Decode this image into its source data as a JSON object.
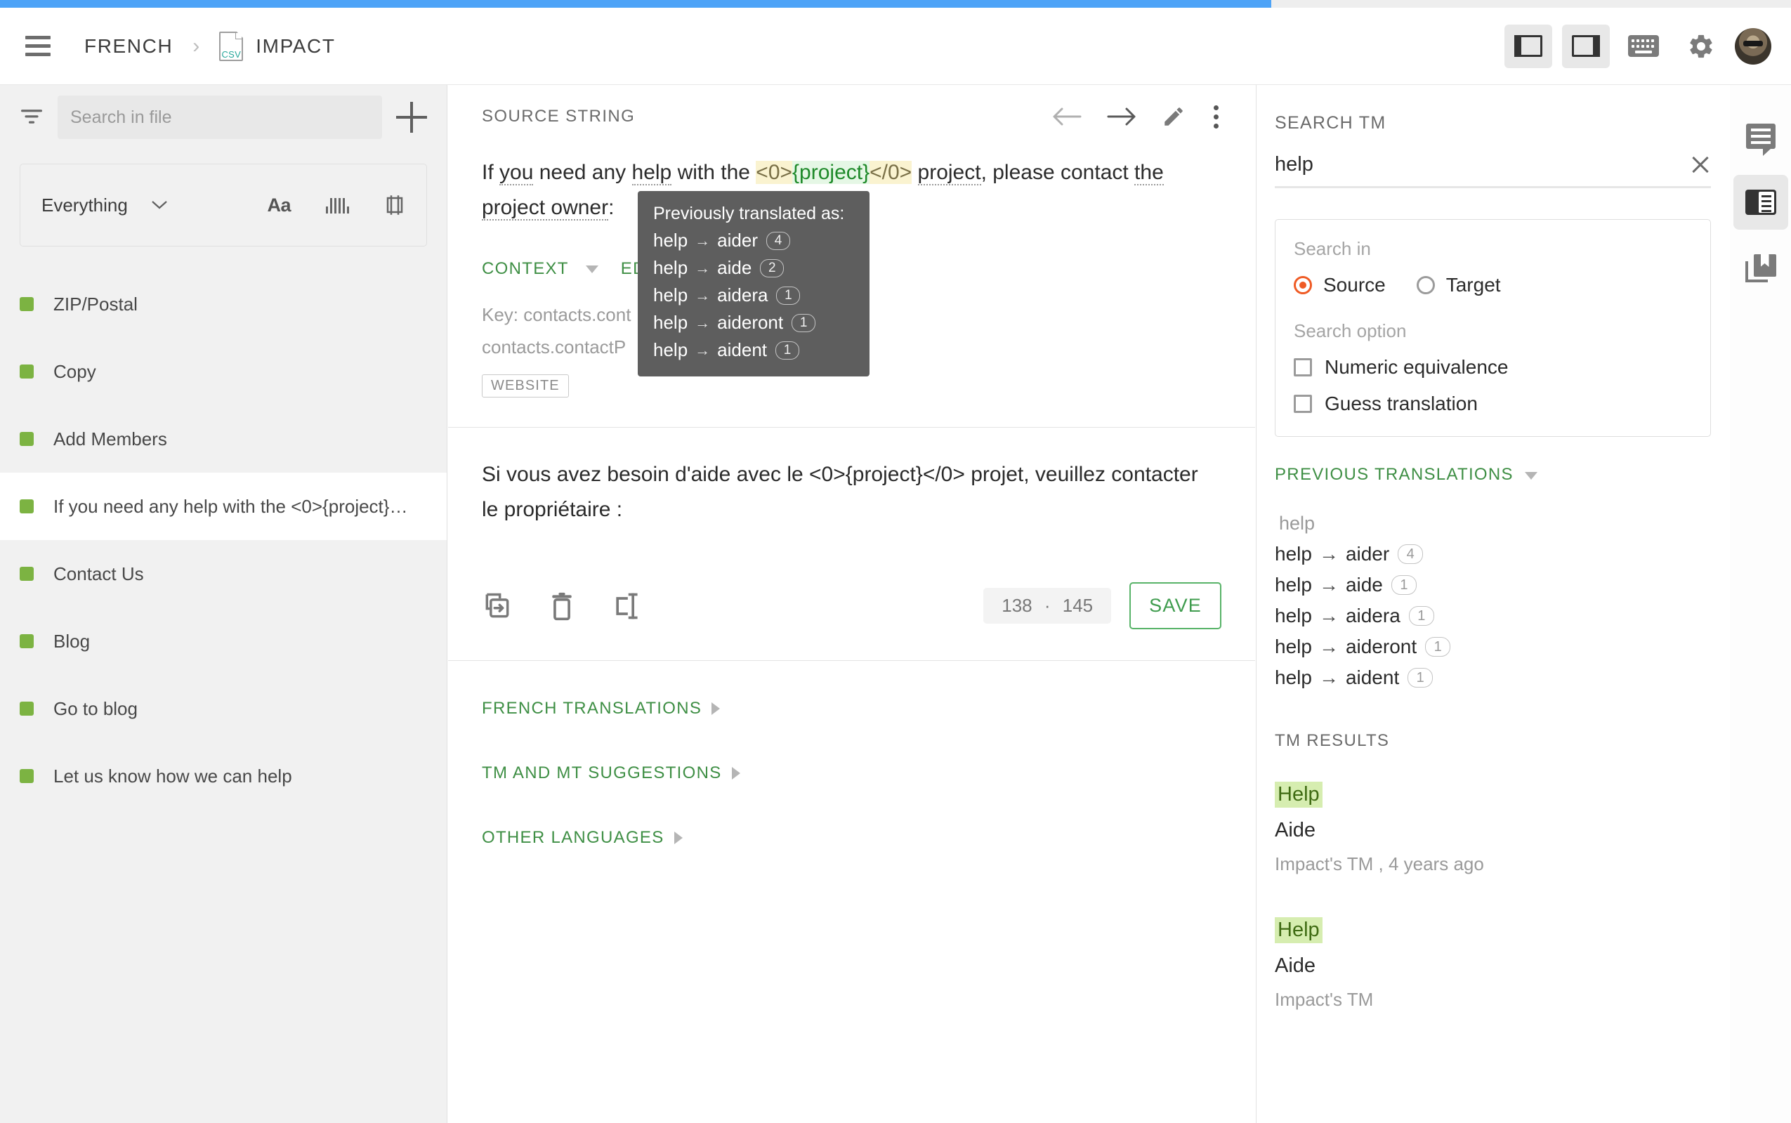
{
  "progress": {
    "percent": 71
  },
  "appbar": {
    "menu_icon": "hamburger-icon",
    "breadcrumb_language": "FRENCH",
    "breadcrumb_separator": "›",
    "file_type_label": "CSV",
    "breadcrumb_file": "IMPACT",
    "layout_left_icon": "layout-left-icon",
    "layout_right_icon": "layout-right-icon",
    "keyboard_icon": "keyboard-icon",
    "settings_icon": "gear-icon",
    "avatar_icon": "user-avatar"
  },
  "sidebar": {
    "filter_icon": "filter-icon",
    "search_placeholder": "Search in file",
    "search_value": "",
    "add_icon": "plus-icon",
    "scope_label": "Everything",
    "chevron_icon": "chevron-down-icon",
    "match_case_label": "Aa",
    "bars_icon": "bars-icon",
    "placeholder_icon": "placeholder-icon",
    "items": [
      {
        "label": "ZIP/Postal",
        "selected": false
      },
      {
        "label": "Copy",
        "selected": false
      },
      {
        "label": "Add Members",
        "selected": false
      },
      {
        "label": "If you need any help with the <0>{project}…",
        "selected": true
      },
      {
        "label": "Contact Us",
        "selected": false
      },
      {
        "label": "Blog",
        "selected": false
      },
      {
        "label": "Go to blog",
        "selected": false
      },
      {
        "label": "Let us know how we can help",
        "selected": false
      }
    ]
  },
  "center": {
    "source_title": "SOURCE STRING",
    "prev_icon": "arrow-left-icon",
    "next_icon": "arrow-right-icon",
    "edit_icon": "pencil-icon",
    "more_icon": "kebab-menu-icon",
    "source_parts": {
      "p1": "If ",
      "w1": "you",
      "p2": " need any ",
      "w2": "help",
      "p3": " with the ",
      "tag_open": "<0>",
      "variable": "{project}",
      "tag_close": "</0>",
      "p4": " ",
      "w3": "project",
      "p5": ", please contact ",
      "w4": "the",
      "p6": " ",
      "w5": "project owner",
      "p7": ":"
    },
    "context_label": "CONTEXT",
    "edit_label": "EDIT",
    "key_line_1": "Key: contacts.cont",
    "key_line_2": "contacts.contactP",
    "website_chip": "WEBSITE",
    "target_text": "Si vous avez besoin d'aide avec le <0>{project}</0> projet, veuillez contacter le propriétaire :",
    "copy_source_icon": "copy-source-icon",
    "clear_icon": "trash-icon",
    "placeholder_insert_icon": "insert-placeholder-icon",
    "char_count_current": "138",
    "char_count_separator": "·",
    "char_count_limit": "145",
    "save_label": "SAVE",
    "sections": [
      {
        "label": "FRENCH TRANSLATIONS"
      },
      {
        "label": "TM AND MT SUGGESTIONS"
      },
      {
        "label": "OTHER LANGUAGES"
      }
    ]
  },
  "tooltip": {
    "title": "Previously translated as:",
    "rows": [
      {
        "source": "help",
        "arrow": "→",
        "target": "aider",
        "count": "4"
      },
      {
        "source": "help",
        "arrow": "→",
        "target": "aide",
        "count": "2"
      },
      {
        "source": "help",
        "arrow": "→",
        "target": "aidera",
        "count": "1"
      },
      {
        "source": "help",
        "arrow": "→",
        "target": "aideront",
        "count": "1"
      },
      {
        "source": "help",
        "arrow": "→",
        "target": "aident",
        "count": "1"
      }
    ]
  },
  "right_panel": {
    "title": "SEARCH TM",
    "search_value": "help",
    "search_placeholder": "",
    "clear_icon": "close-icon",
    "search_in_label": "Search in",
    "radio_source": "Source",
    "radio_target": "Target",
    "selected_radio": "Source",
    "search_option_label": "Search option",
    "checkbox_numeric": "Numeric equivalence",
    "checkbox_guess": "Guess translation",
    "previous_translations_label": "PREVIOUS TRANSLATIONS",
    "previous_chevron_icon": "triangle-down-icon",
    "previous_query": "help",
    "previous_rows": [
      {
        "source": "help",
        "arrow": "→",
        "target": "aider",
        "count": "4"
      },
      {
        "source": "help",
        "arrow": "→",
        "target": "aide",
        "count": "1"
      },
      {
        "source": "help",
        "arrow": "→",
        "target": "aidera",
        "count": "1"
      },
      {
        "source": "help",
        "arrow": "→",
        "target": "aideront",
        "count": "1"
      },
      {
        "source": "help",
        "arrow": "→",
        "target": "aident",
        "count": "1"
      }
    ],
    "tm_results_label": "TM RESULTS",
    "tm_results": [
      {
        "source": "Help",
        "target": "Aide",
        "meta": "Impact's TM , 4 years ago"
      },
      {
        "source": "Help",
        "target": "Aide",
        "meta": "Impact's TM"
      }
    ]
  },
  "rail": {
    "comments_icon": "comment-icon",
    "tm_panel_icon": "tm-panel-icon",
    "glossary_icon": "glossary-icon"
  },
  "colors": {
    "accent_green": "#3f8f45",
    "progress_blue": "#4da3f7",
    "radio_orange": "#ef5b25",
    "highlight_green": "#d6edb0",
    "string_dot_green": "#7cb342",
    "tooltip_bg": "#5e5e5e"
  }
}
